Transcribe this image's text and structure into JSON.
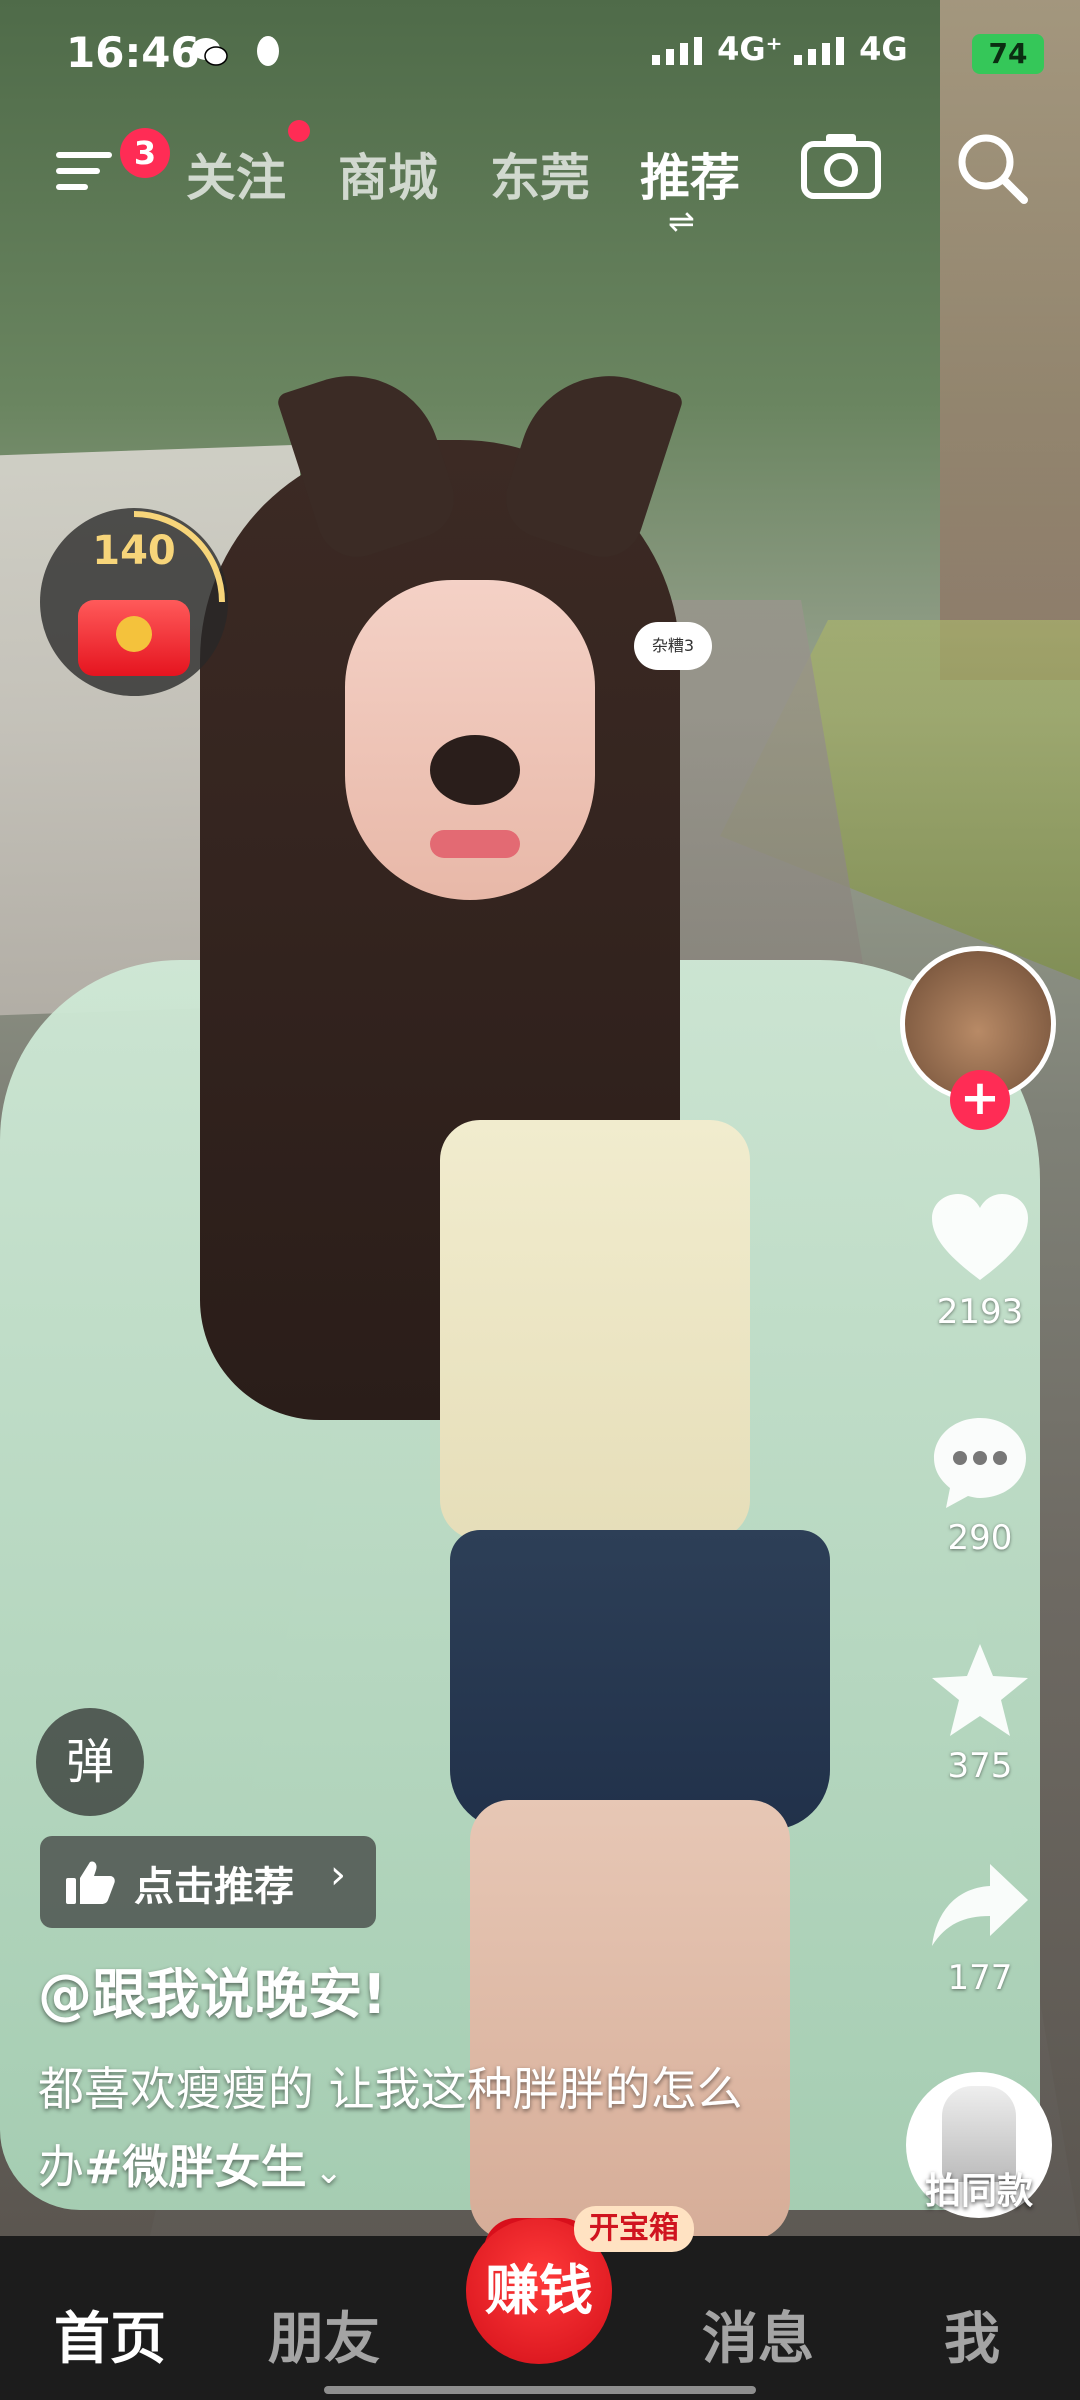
{
  "status_bar": {
    "time": "16:46",
    "network_1": "4G⁺",
    "network_2": "4G",
    "battery": "74"
  },
  "top_nav": {
    "menu_badge": "3",
    "tabs": [
      {
        "label": "关注",
        "active": false
      },
      {
        "label": "商城",
        "active": false
      },
      {
        "label": "东莞",
        "active": false
      },
      {
        "label": "推荐",
        "active": true
      }
    ],
    "active_switch_glyph": "⇌"
  },
  "red_packet": {
    "count": "140"
  },
  "video_bubble": "杂糟3",
  "sidebar": {
    "likes": "2193",
    "comments": "290",
    "favorites": "375",
    "shares": "177",
    "follow_glyph": "+",
    "same_style_label": "拍同款"
  },
  "post": {
    "danmu_label": "弹",
    "recommend_label": "点击推荐",
    "recommend_chevron": "›",
    "author": "@跟我说晚安!",
    "caption": "都喜欢瘦瘦的 让我这种胖胖的怎么办",
    "hashtag": "#微胖女生",
    "more_glyph": "⌄"
  },
  "bottom_nav": {
    "items": [
      {
        "label": "首页",
        "active": true
      },
      {
        "label": "朋友",
        "active": false
      },
      {
        "label": "消息",
        "active": false
      },
      {
        "label": "我",
        "active": false
      }
    ],
    "earn_label": "赚钱",
    "chest_label": "开宝箱"
  },
  "colors": {
    "accent": "#ff2c55",
    "battery": "#35c759",
    "nav_bg": "#1c1c1c"
  }
}
